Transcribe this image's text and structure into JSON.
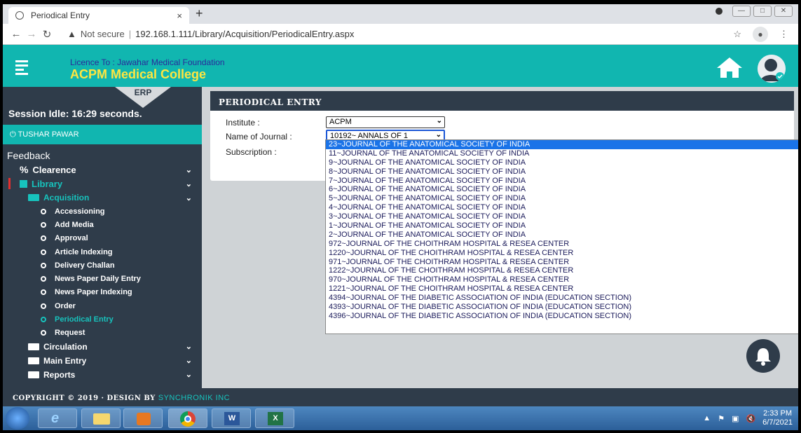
{
  "browser": {
    "tab_title": "Periodical Entry",
    "tab_close": "×",
    "new_tab": "+",
    "security_text": "Not secure",
    "url": "192.168.1.111/Library/Acquisition/PeriodicalEntry.aspx"
  },
  "header": {
    "licence": "Licence To : Jawahar Medical Foundation",
    "college": "ACPM Medical College"
  },
  "sidebar": {
    "erp_label": "ERP",
    "session": "Session Idle: 16:29 seconds.",
    "user": "TUSHAR PAWAR",
    "feedback": "Feedback",
    "clearence": "Clearence",
    "library": "Library",
    "acquisition": "Acquisition",
    "sub_items": [
      "Accessioning",
      "Add Media",
      "Approval",
      "Article Indexing",
      "Delivery Challan",
      "News Paper Daily Entry",
      "News Paper Indexing",
      "Order",
      "Periodical Entry",
      "Request"
    ],
    "circulation": "Circulation",
    "main_entry": "Main Entry",
    "reports": "Reports"
  },
  "panel": {
    "title": "PERIODICAL ENTRY",
    "institute_label": "Institute :",
    "institute_value": "ACPM",
    "journal_label": "Name of Journal :",
    "journal_value": "10192~ ANNALS OF 1",
    "subscription_label": "Subscription :"
  },
  "dropdown_options": [
    "23~JOURNAL OF THE ANATOMICAL SOCIETY OF INDIA",
    "11~JOURNAL OF THE ANATOMICAL SOCIETY OF INDIA",
    "9~JOURNAL OF THE ANATOMICAL SOCIETY OF INDIA",
    "8~JOURNAL OF THE ANATOMICAL SOCIETY OF INDIA",
    "7~JOURNAL OF THE ANATOMICAL SOCIETY OF INDIA",
    "6~JOURNAL OF THE ANATOMICAL SOCIETY OF INDIA",
    "5~JOURNAL OF THE ANATOMICAL SOCIETY OF INDIA",
    "4~JOURNAL OF THE ANATOMICAL SOCIETY OF INDIA",
    "3~JOURNAL OF THE ANATOMICAL SOCIETY OF INDIA",
    "1~JOURNAL OF THE ANATOMICAL SOCIETY OF INDIA",
    "2~JOURNAL OF THE ANATOMICAL SOCIETY OF INDIA",
    "972~JOURNAL OF THE CHOITHRAM HOSPITAL & RESEA CENTER",
    "1220~JOURNAL OF THE CHOITHRAM HOSPITAL & RESEA CENTER",
    "971~JOURNAL OF THE CHOITHRAM HOSPITAL & RESEA CENTER",
    "1222~JOURNAL OF THE CHOITHRAM HOSPITAL & RESEA CENTER",
    "970~JOURNAL OF THE CHOITHRAM HOSPITAL & RESEA CENTER",
    "1221~JOURNAL OF THE CHOITHRAM HOSPITAL & RESEA CENTER",
    "4394~JOURNAL OF THE DIABETIC ASSOCIATION OF INDIA (EDUCATION SECTION)",
    "4393~JOURNAL OF THE DIABETIC ASSOCIATION OF INDIA (EDUCATION SECTION)",
    "4396~JOURNAL OF THE DIABETIC ASSOCIATION OF INDIA (EDUCATION SECTION)"
  ],
  "footer": {
    "copyright": "COPYRIGHT © 2019 · DESIGN BY",
    "brand": "SYNCHRONIK INC"
  },
  "taskbar": {
    "time": "2:33 PM",
    "date": "6/7/2021"
  },
  "colors": {
    "teal": "#11b6b0",
    "sidebar": "#2f3c4a",
    "highlight": "#1a73e8",
    "college_yellow": "#ffe640"
  }
}
